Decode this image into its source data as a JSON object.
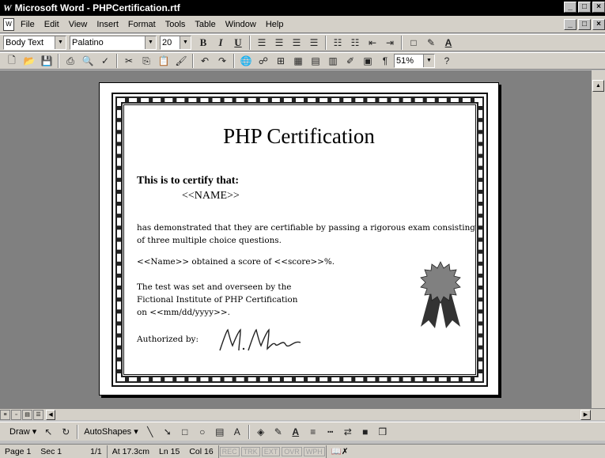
{
  "window": {
    "logo": "W",
    "title": "Microsoft Word - PHPCertification.rtf",
    "min": "_",
    "max": "□",
    "close": "×"
  },
  "menu": [
    "File",
    "Edit",
    "View",
    "Insert",
    "Format",
    "Tools",
    "Table",
    "Window",
    "Help"
  ],
  "format_toolbar": {
    "style": "Body Text",
    "font": "Palatino",
    "size": "20",
    "bold": "B",
    "italic": "I",
    "underline": "U"
  },
  "standard_toolbar": {
    "zoom": "51%",
    "pilcrow": "¶"
  },
  "certificate": {
    "title": "PHP Certification",
    "certify_line": "This is to certify that:",
    "name_placeholder": "<<NAME>>",
    "para1": "has demonstrated that they are certifiable by passing a rigorous exam consisting of three multiple choice questions.",
    "para2": "<<Name>> obtained a score of <<score>>%.",
    "para3_line1": "The test was set and overseen by the",
    "para3_line2": "Fictional Institute of PHP Certification",
    "para3_line3": "on <<mm/dd/yyyy>>.",
    "authorized": "Authorized by:",
    "signature_text": "M. Morse"
  },
  "draw_toolbar": {
    "draw": "Draw ▾",
    "autoshapes": "AutoShapes ▾"
  },
  "status": {
    "page": "Page 1",
    "sec": "Sec 1",
    "pages": "1/1",
    "at": "At 17.3cm",
    "ln": "Ln 15",
    "col": "Col 16",
    "rec": "REC",
    "trk": "TRK",
    "ext": "EXT",
    "ovr": "OVR",
    "wph": "WPH"
  },
  "colors": {
    "titlebar": "#000000",
    "chrome": "#d4d0c8",
    "workspace": "#808080",
    "ribbon_badge": "#808080"
  }
}
